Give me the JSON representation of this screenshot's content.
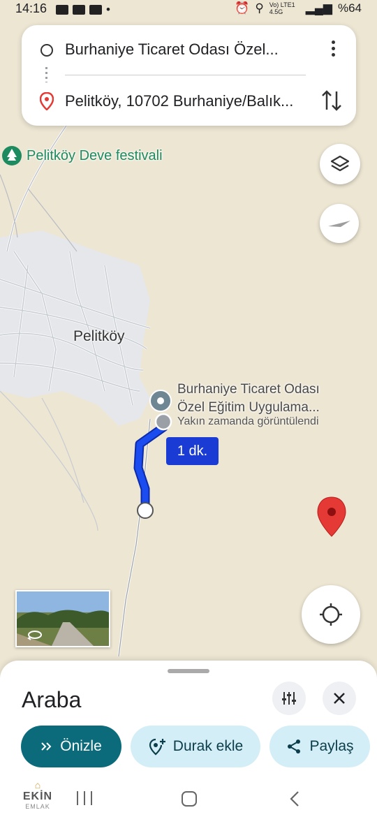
{
  "status_bar": {
    "time": "14:16",
    "network": "Vo) LTE1 4.5G",
    "battery": "%64"
  },
  "directions": {
    "from": "Burhaniye Ticaret Odası Özel...",
    "to": "Pelitköy, 10702 Burhaniye/Balık..."
  },
  "map": {
    "poi_label": "Pelitköy Deve festivali",
    "town_label": "Pelitköy",
    "destination_name_line1": "Burhaniye Ticaret Odası",
    "destination_name_line2": "Özel Eğitim Uygulama...",
    "destination_note": "Yakın zamanda görüntülendi",
    "eta_label": "1 dk."
  },
  "sheet": {
    "mode": "Araba",
    "preview_button": "Önizle",
    "add_stop_button": "Durak ekle",
    "share_button": "Paylaş"
  },
  "watermark": {
    "line1": "EKİN",
    "line2": "EMLAK"
  },
  "colors": {
    "route": "#1a3cd4",
    "primary_button": "#0b6b7a",
    "secondary_button": "#d3eef6",
    "poi_green": "#1e8a5f",
    "dest_pin": "#e53935"
  }
}
